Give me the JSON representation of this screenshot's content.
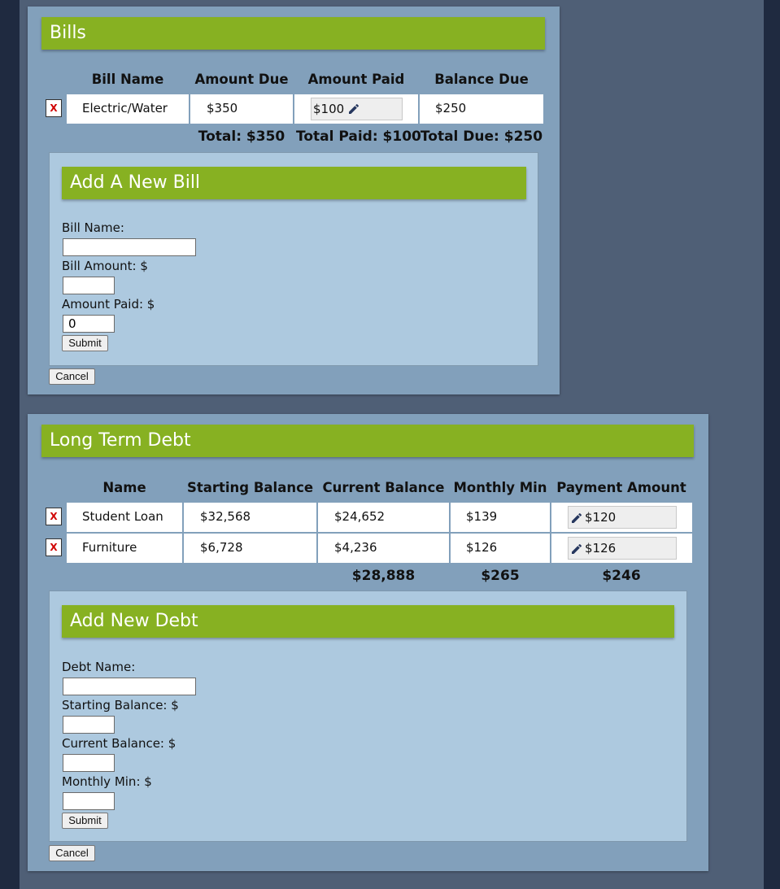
{
  "bills": {
    "title": "Bills",
    "columns": [
      "Bill Name",
      "Amount Due",
      "Amount Paid",
      "Balance Due"
    ],
    "rows": [
      {
        "delete": "X",
        "name": "Electric/Water",
        "amount_due": "$350",
        "amount_paid": "$100",
        "balance_due": "$250"
      }
    ],
    "totals": {
      "total": "Total: $350",
      "total_paid": "Total Paid: $100",
      "total_due": "Total Due: $250"
    },
    "form": {
      "title": "Add A New Bill",
      "name_label": "Bill Name:",
      "name_value": "",
      "amount_label": "Bill Amount: $",
      "amount_value": "",
      "paid_label": "Amount Paid: $",
      "paid_value": "0",
      "submit": "Submit"
    },
    "cancel": "Cancel"
  },
  "debt": {
    "title": "Long Term Debt",
    "columns": [
      "Name",
      "Starting Balance",
      "Current Balance",
      "Monthly Min",
      "Payment Amount"
    ],
    "rows": [
      {
        "delete": "X",
        "name": "Student Loan",
        "starting": "$32,568",
        "current": "$24,652",
        "min": "$139",
        "payment": "$120"
      },
      {
        "delete": "X",
        "name": "Furniture",
        "starting": "$6,728",
        "current": "$4,236",
        "min": "$126",
        "payment": "$126"
      }
    ],
    "totals": {
      "current": "$28,888",
      "min": "$265",
      "payment": "$246"
    },
    "form": {
      "title": "Add New Debt",
      "name_label": "Debt Name:",
      "name_value": "",
      "starting_label": "Starting Balance: $",
      "starting_value": "",
      "current_label": "Current Balance: $",
      "current_value": "",
      "min_label": "Monthly Min: $",
      "min_value": "",
      "submit": "Submit"
    },
    "cancel": "Cancel"
  },
  "icons": {
    "edit": "pencil-icon",
    "delete": "x-icon"
  },
  "colors": {
    "accent": "#87b122",
    "panel": "#82a0bb",
    "subpanel": "#adc9df",
    "delete": "#d00000",
    "pencil": "#26375e"
  }
}
